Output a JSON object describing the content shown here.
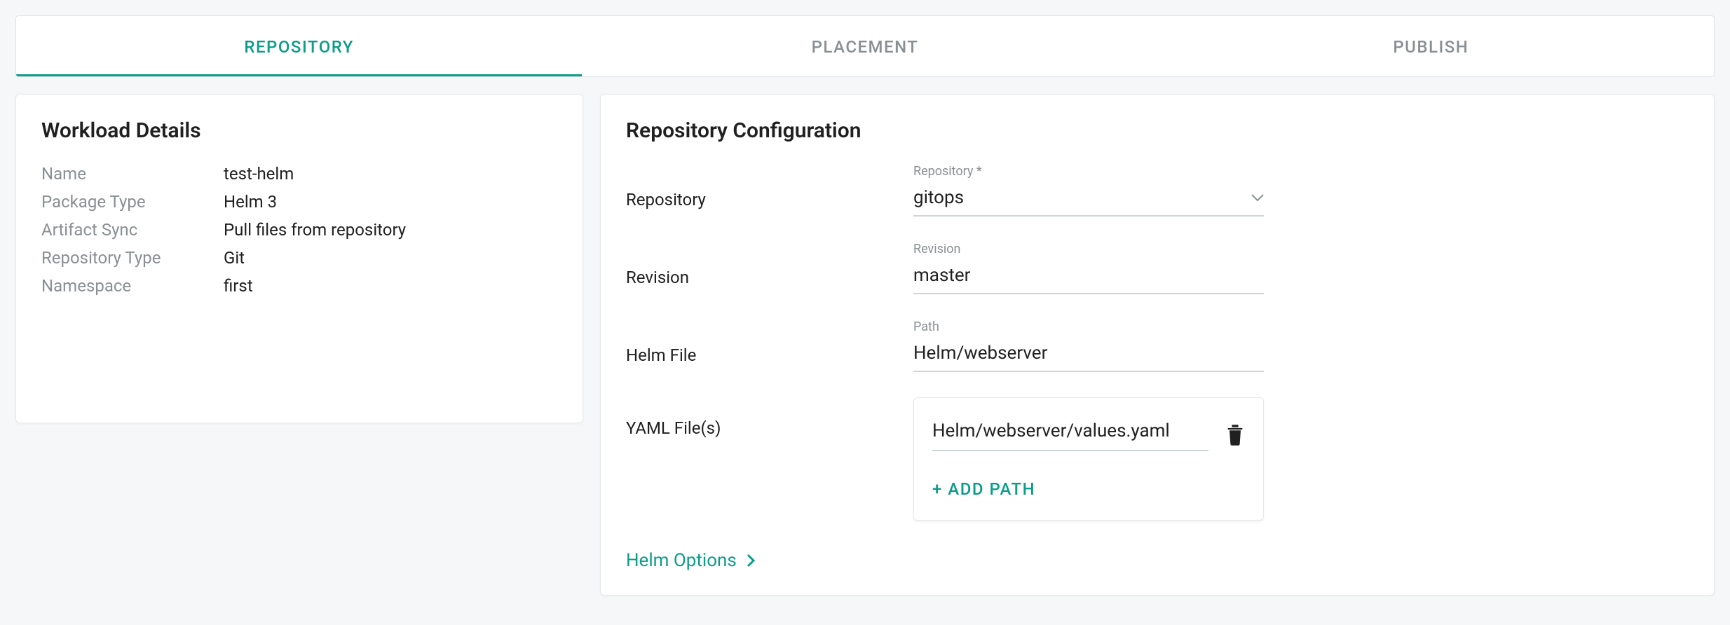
{
  "tabs": {
    "repository": "REPOSITORY",
    "placement": "PLACEMENT",
    "publish": "PUBLISH"
  },
  "workload": {
    "title": "Workload Details",
    "rows": {
      "name_label": "Name",
      "name_value": "test-helm",
      "pkg_label": "Package Type",
      "pkg_value": "Helm 3",
      "sync_label": "Artifact Sync",
      "sync_value": "Pull files from repository",
      "repo_label": "Repository Type",
      "repo_value": "Git",
      "ns_label": "Namespace",
      "ns_value": "first"
    }
  },
  "repo_cfg": {
    "title": "Repository Configuration",
    "repository_row_label": "Repository",
    "repository_float": "Repository *",
    "repository_value": "gitops",
    "revision_row_label": "Revision",
    "revision_float": "Revision",
    "revision_value": "master",
    "helmfile_row_label": "Helm File",
    "path_float": "Path",
    "path_value": "Helm/webserver",
    "yaml_row_label": "YAML File(s)",
    "yaml_value": "Helm/webserver/values.yaml",
    "add_path": "+ ADD  PATH",
    "helm_options": "Helm Options"
  }
}
